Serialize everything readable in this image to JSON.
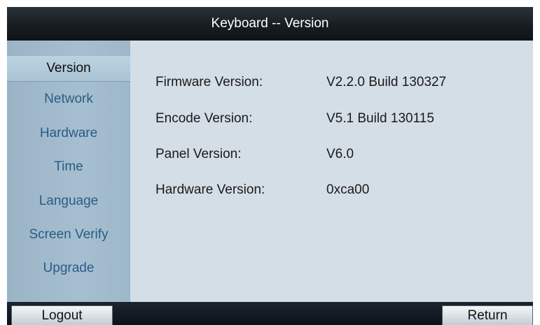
{
  "title": "Keyboard -- Version",
  "sidebar": {
    "items": [
      {
        "label": "Version",
        "active": true
      },
      {
        "label": "Network",
        "active": false
      },
      {
        "label": "Hardware",
        "active": false
      },
      {
        "label": "Time",
        "active": false
      },
      {
        "label": "Language",
        "active": false
      },
      {
        "label": "Screen Verify",
        "active": false
      },
      {
        "label": "Upgrade",
        "active": false
      }
    ]
  },
  "version_info": {
    "firmware": {
      "label": "Firmware Version:",
      "value": "V2.2.0 Build 130327"
    },
    "encode": {
      "label": "Encode Version:",
      "value": "V5.1 Build 130115"
    },
    "panel": {
      "label": "Panel Version:",
      "value": "V6.0"
    },
    "hardware": {
      "label": "Hardware Version:",
      "value": "0xca00"
    }
  },
  "footer": {
    "logout_label": "Logout",
    "return_label": "Return"
  },
  "colors": {
    "titlebar": "#181d22",
    "sidebar": "#a6bfd0",
    "sidebar_text": "#2a5c85",
    "content_bg": "#d4dee7"
  }
}
